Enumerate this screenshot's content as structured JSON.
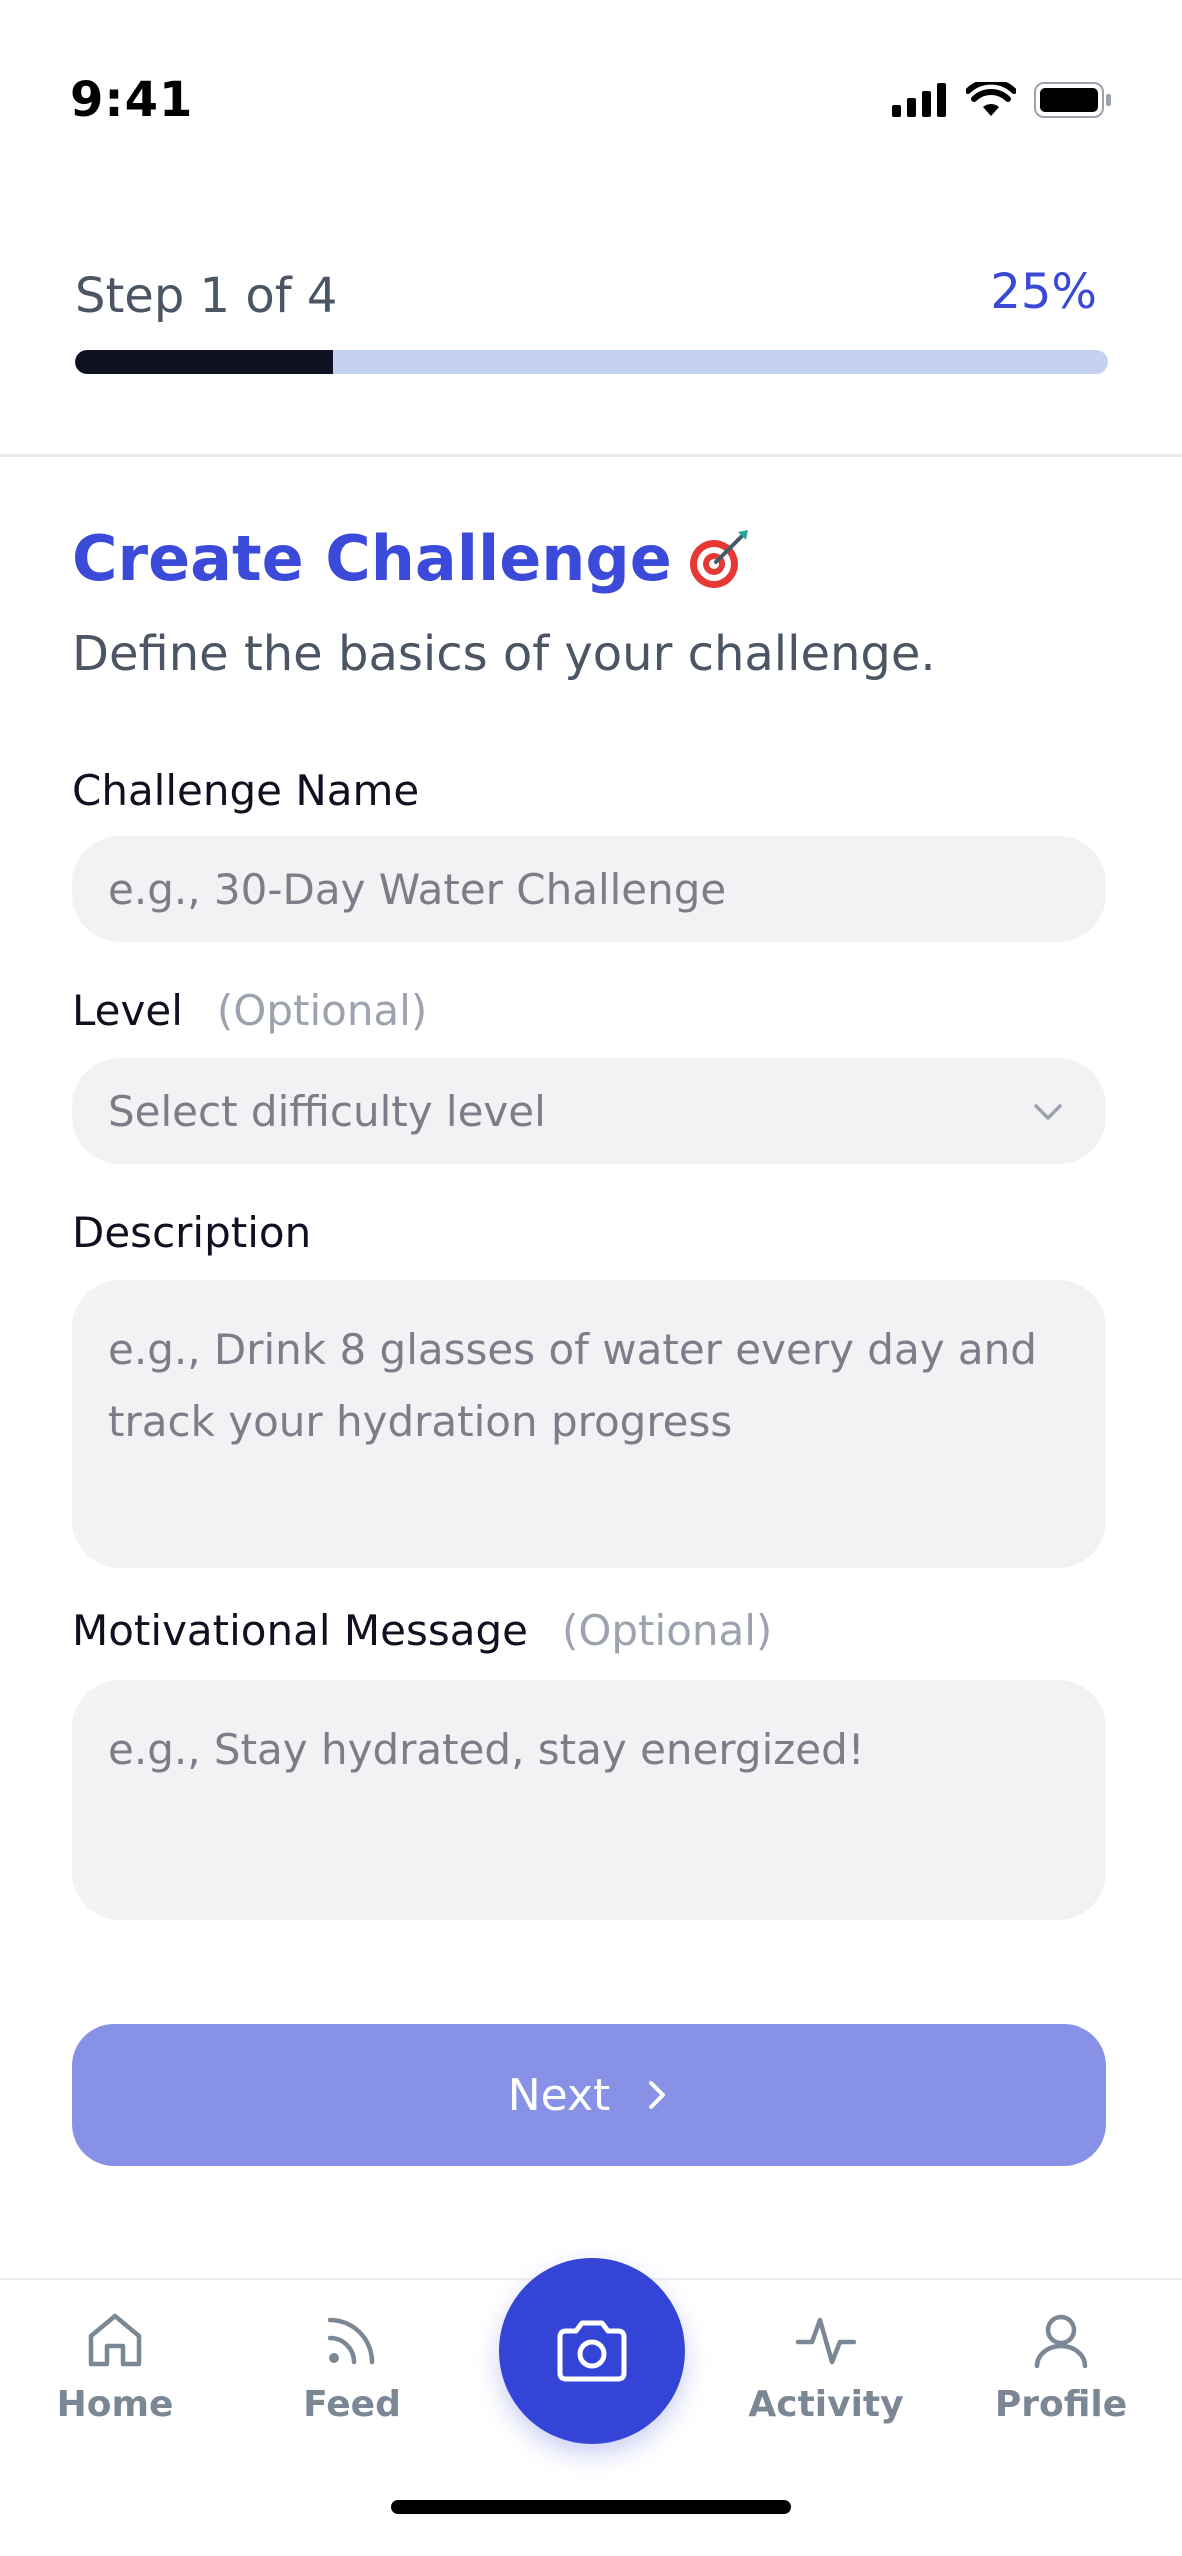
{
  "status_bar": {
    "time": "9:41"
  },
  "progress": {
    "step_label": "Step 1 of 4",
    "percent_label": "25%",
    "fraction": 0.25
  },
  "header": {
    "title": "Create Challenge",
    "title_icon": "dart-target-icon",
    "subtitle": "Define the basics of your challenge."
  },
  "form": {
    "challenge_name": {
      "label": "Challenge Name",
      "placeholder": "e.g., 30-Day Water Challenge"
    },
    "level": {
      "label": "Level",
      "optional": "(Optional)",
      "placeholder": "Select difficulty level"
    },
    "description": {
      "label": "Description",
      "placeholder": "e.g., Drink 8 glasses of water every day and track your hydration progress"
    },
    "motivational_message": {
      "label": "Motivational Message",
      "optional": "(Optional)",
      "placeholder": "e.g., Stay hydrated, stay energized!"
    }
  },
  "next_button": {
    "label": "Next"
  },
  "bottom_nav": {
    "items": [
      {
        "label": "Home",
        "icon": "home-icon"
      },
      {
        "label": "Feed",
        "icon": "feed-icon"
      },
      {
        "label": "Activity",
        "icon": "activity-icon"
      },
      {
        "label": "Profile",
        "icon": "profile-icon"
      }
    ],
    "center_icon": "camera-icon"
  },
  "colors": {
    "accent": "#3b4ad8",
    "progress_fill": "#0f1121",
    "progress_track": "#c5d1f3",
    "next_button": "#8792e6",
    "input_bg": "#f2f2f4"
  }
}
